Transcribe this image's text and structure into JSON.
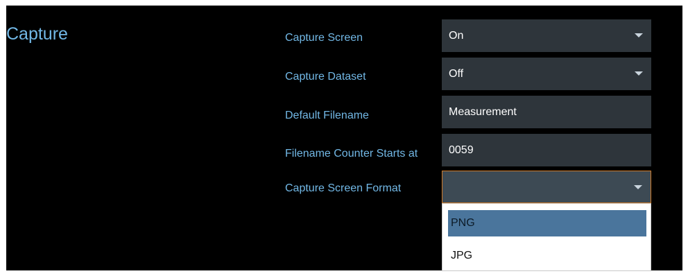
{
  "panel": {
    "title": "Capture"
  },
  "rows": [
    {
      "label": "Capture Screen",
      "value": "On"
    },
    {
      "label": "Capture Dataset",
      "value": "Off"
    },
    {
      "label": "Default Filename",
      "value": "Measurement"
    },
    {
      "label": "Filename Counter Starts at",
      "value": "0059"
    },
    {
      "label": "Capture Screen Format",
      "value": ""
    }
  ],
  "dropdown": {
    "options": [
      {
        "label": "PNG",
        "selected": true
      },
      {
        "label": "JPG",
        "selected": false
      }
    ]
  },
  "colors": {
    "background": "#000000",
    "label": "#72b8e6",
    "field": "#2e353b",
    "active_border": "#d07c2a",
    "selected_option": "#4a759c"
  }
}
